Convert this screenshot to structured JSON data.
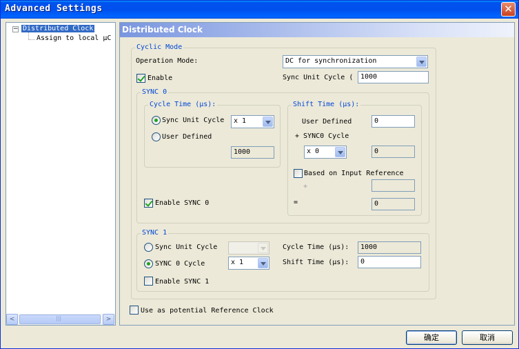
{
  "window": {
    "title": "Advanced Settings",
    "close_symbol": "✕"
  },
  "tree": {
    "expander": "−",
    "items": [
      {
        "label": "Distributed Clock"
      },
      {
        "label": "Assign to local μC"
      }
    ]
  },
  "scrollbar": {
    "left": "<",
    "right": ">",
    "grip": "|||"
  },
  "panel": {
    "title": "Distributed Clock"
  },
  "cyclic_mode": {
    "title": "Cyclic Mode",
    "operation_mode_label": "Operation Mode:",
    "operation_mode_value": "DC for synchronization",
    "enable_label": "Enable",
    "enable_checked": true,
    "sync_unit_cycle_label": "Sync Unit Cycle (",
    "sync_unit_cycle_value": "1000"
  },
  "sync0": {
    "title": "SYNC 0",
    "cycle_time": {
      "title": "Cycle Time (μs):",
      "opt_sync_unit_cycle": "Sync Unit Cycle",
      "opt_user_defined": "User Defined",
      "selected": "Sync Unit Cycle",
      "multiplier": "x 1",
      "user_value": "1000"
    },
    "shift_time": {
      "title": "Shift Time (μs):",
      "user_defined_label": "User Defined",
      "user_defined_value": "0",
      "plus_sync0_label": "+ SYNC0 Cycle",
      "multiplier": "x 0",
      "multiplier_result": "0",
      "based_on_input_label": "Based on Input Reference",
      "based_on_input_checked": false,
      "plus_symbol": "+",
      "input_ref_value": "",
      "equals_symbol": "=",
      "result": "0"
    },
    "enable_label": "Enable SYNC 0",
    "enable_checked": true
  },
  "sync1": {
    "title": "SYNC 1",
    "opt_sync_unit_cycle": "Sync Unit Cycle",
    "opt_sync0_cycle": "SYNC 0 Cycle",
    "selected": "SYNC 0 Cycle",
    "sync_unit_combo_value": "",
    "multiplier": "x 1",
    "cycle_time_label": "Cycle Time (μs):",
    "cycle_time_value": "1000",
    "shift_time_label": "Shift Time (μs):",
    "shift_time_value": "0",
    "enable_label": "Enable SYNC 1",
    "enable_checked": false
  },
  "reference_clock": {
    "label": "Use as potential Reference Clock",
    "checked": false
  },
  "buttons": {
    "ok": "确定",
    "cancel": "取消"
  }
}
